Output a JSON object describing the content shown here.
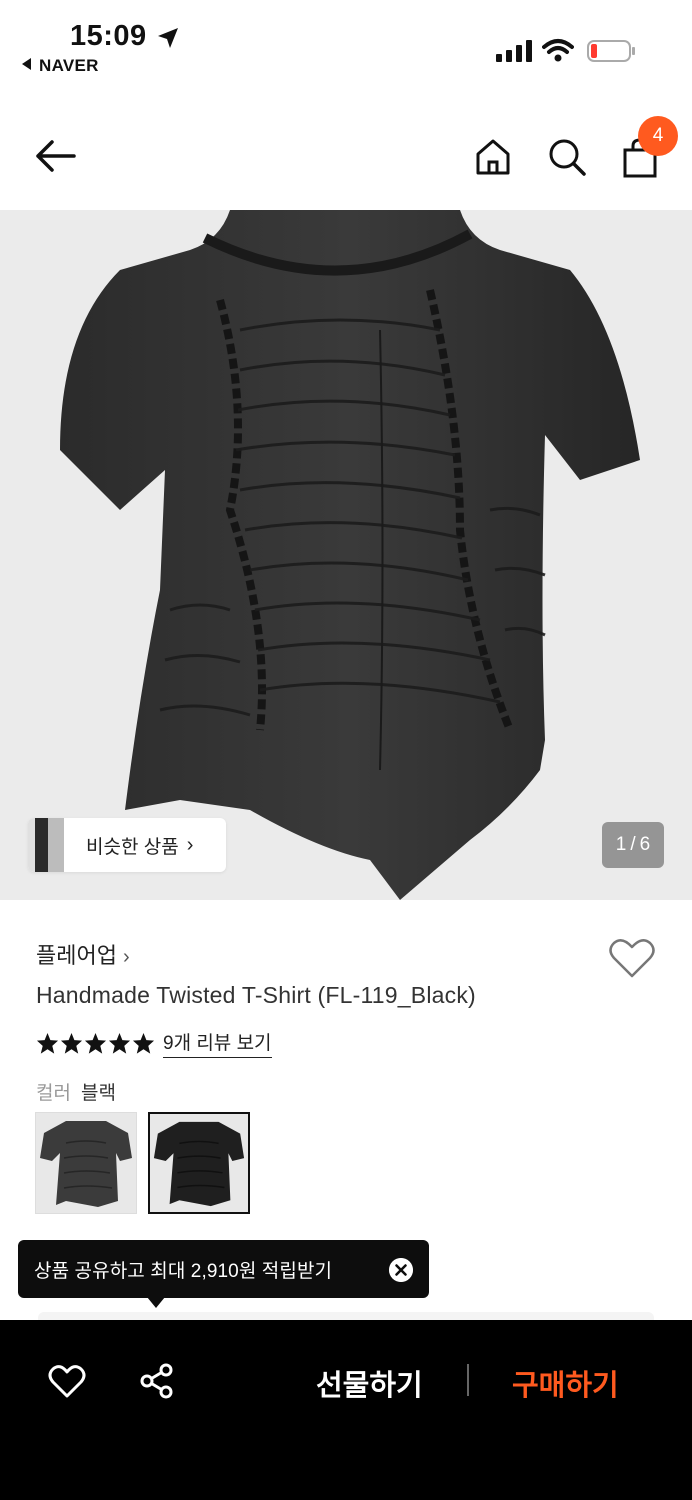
{
  "status_bar": {
    "time": "15:09",
    "back_app": "NAVER"
  },
  "nav": {
    "cart_count": "4",
    "icons": [
      "back-arrow-icon",
      "home-icon",
      "search-icon",
      "shopping-bag-icon"
    ]
  },
  "gallery": {
    "similar_label": "비슷한 상품",
    "current_page": "1",
    "separator": "/",
    "total_pages": "6"
  },
  "product": {
    "brand": "플레어업",
    "title": "Handmade Twisted T-Shirt (FL-119_Black)",
    "rating_stars": 5,
    "review_link": "9개 리뷰 보기",
    "option_label": "컬러",
    "option_value": "블랙"
  },
  "tooltip": {
    "text": "상품 공유하고 최대 2,910원 적립받기"
  },
  "bottom_bar": {
    "gift_label": "선물하기",
    "buy_label": "구매하기"
  },
  "colors": {
    "accent": "#ff5a1f",
    "bar_bg": "#000000",
    "hero_bg": "#ebebeb"
  }
}
